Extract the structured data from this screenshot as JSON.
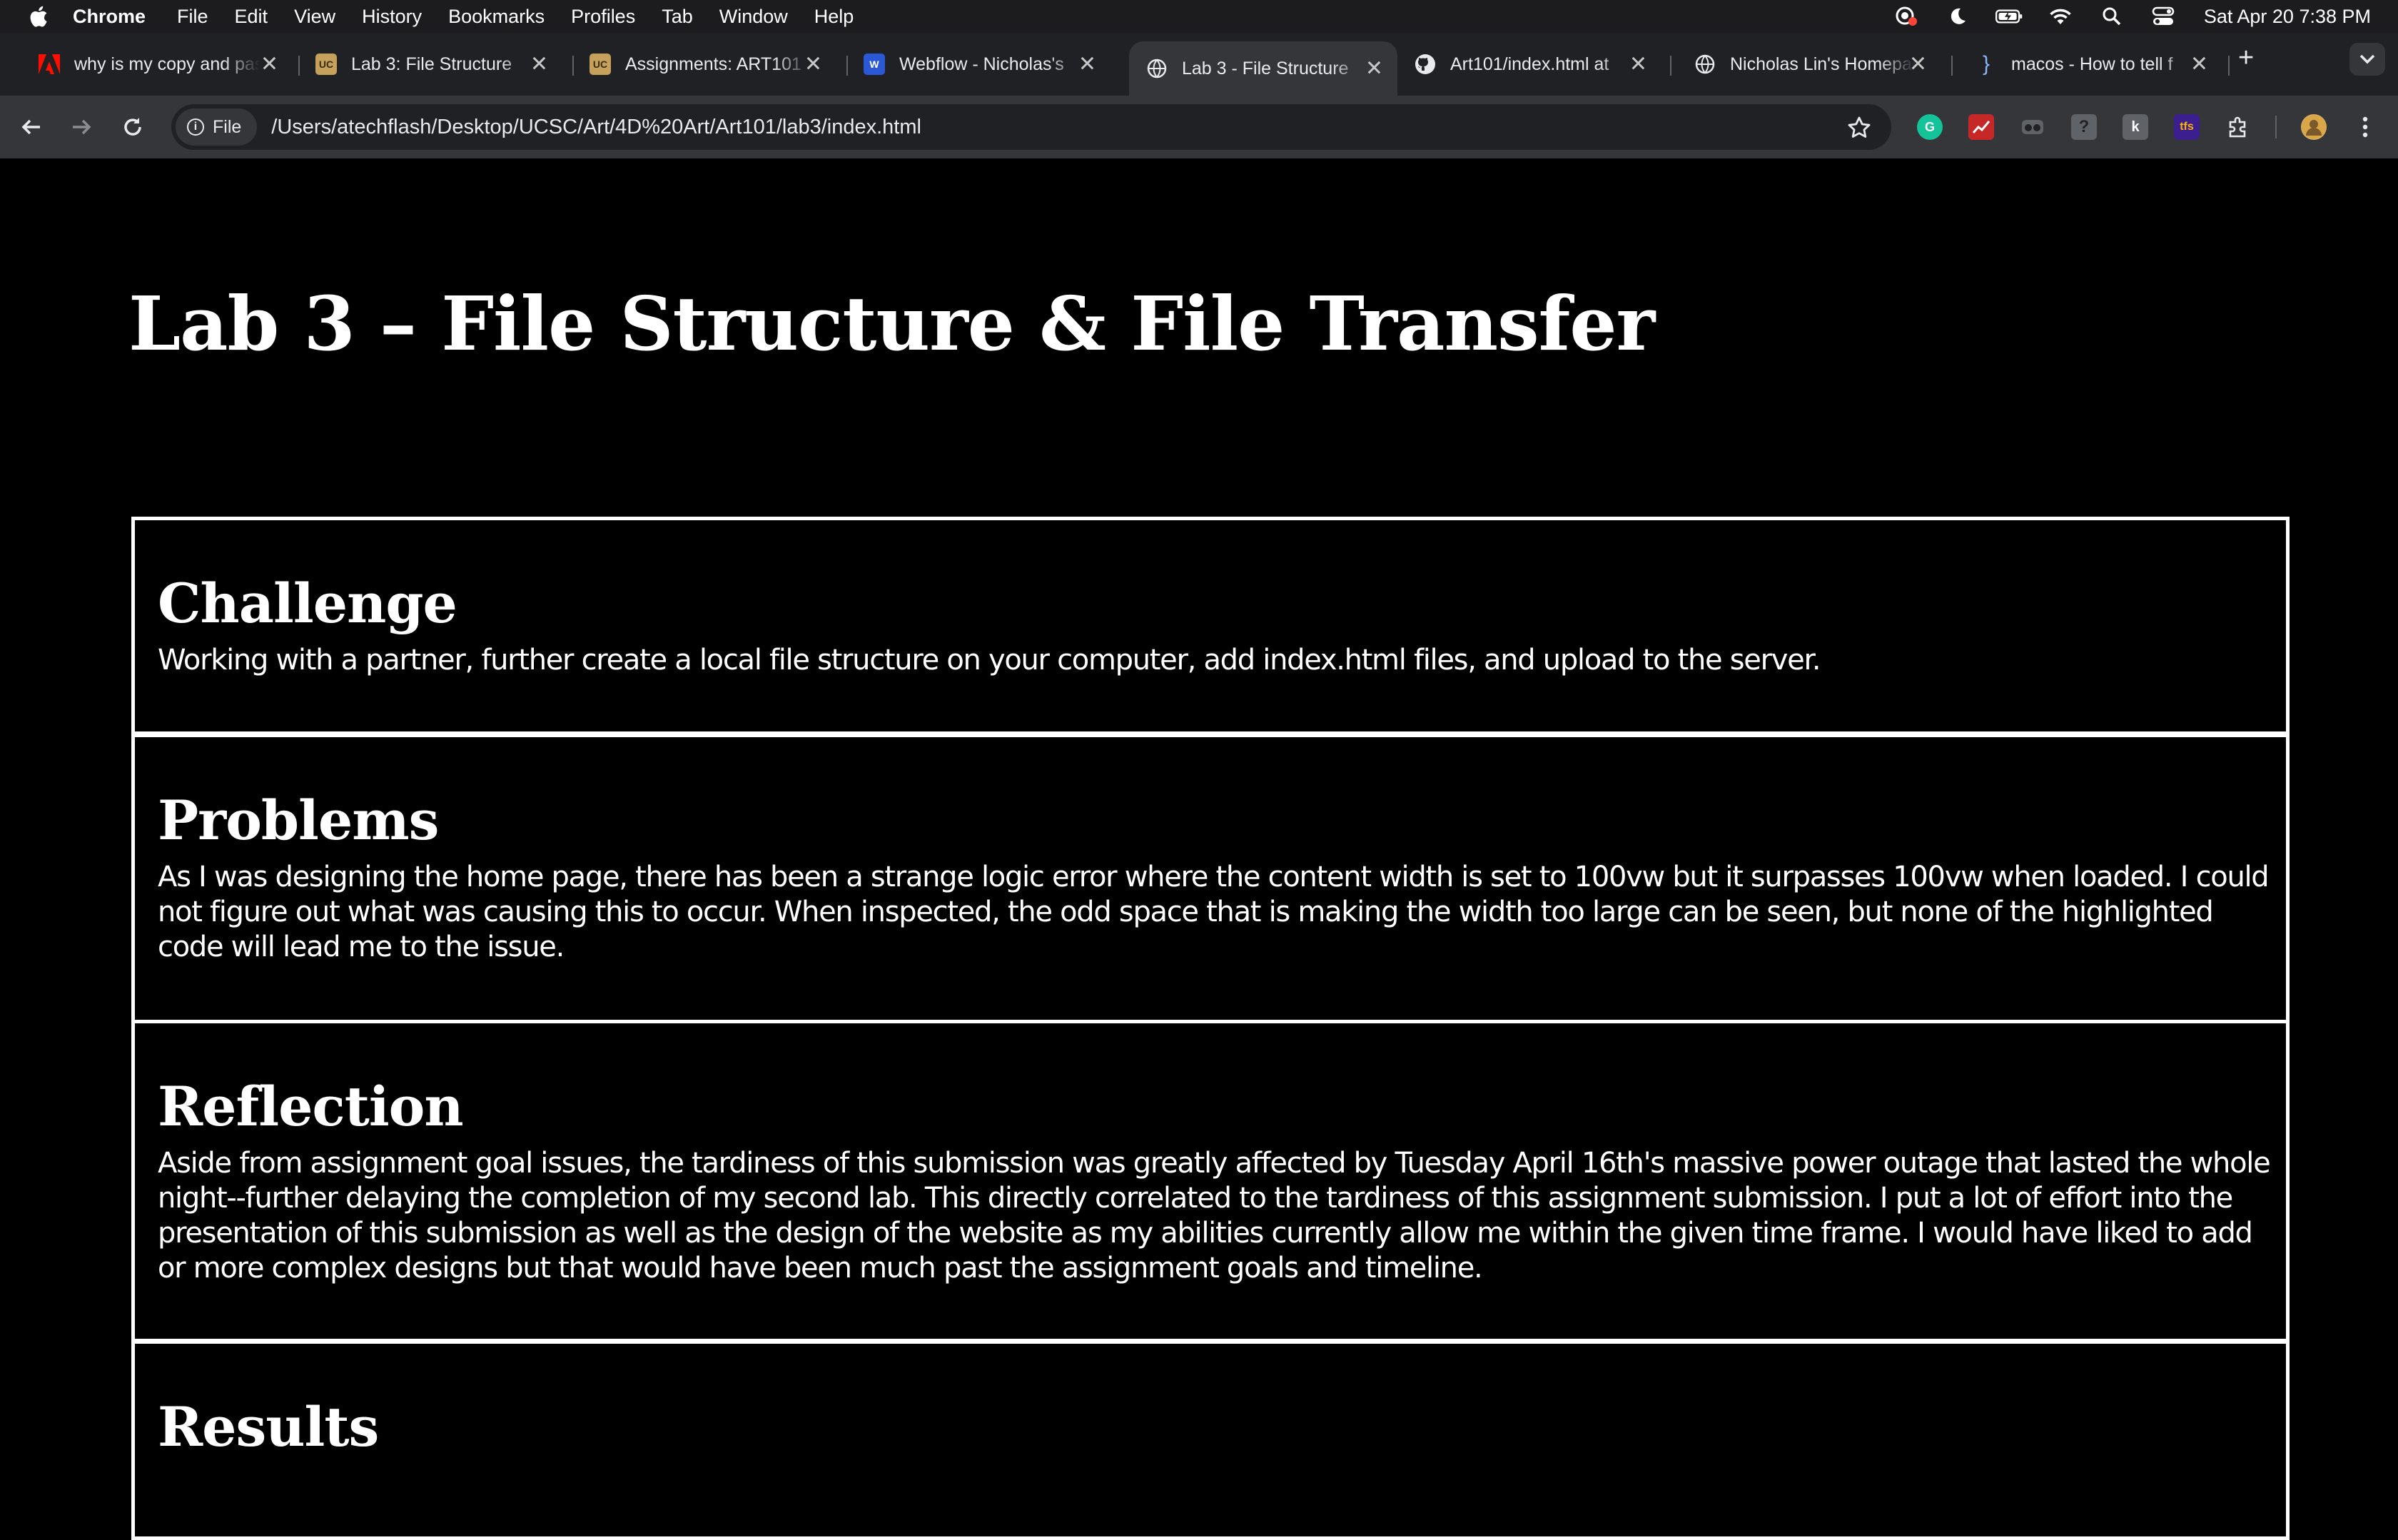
{
  "os_menubar": {
    "app_name": "Chrome",
    "menus": [
      "File",
      "Edit",
      "View",
      "History",
      "Bookmarks",
      "Profiles",
      "Tab",
      "Window",
      "Help"
    ],
    "clock": "Sat Apr 20  7:38 PM"
  },
  "browser": {
    "tabs": [
      {
        "title": "why is my copy and paste",
        "favicon": "adobe-icon",
        "active": false
      },
      {
        "title": "Lab 3: File Structure",
        "favicon": "ucsc-icon",
        "active": false
      },
      {
        "title": "Assignments: ART101",
        "favicon": "ucsc-icon",
        "active": false
      },
      {
        "title": "Webflow - Nicholas's",
        "favicon": "webflow-icon",
        "active": false
      },
      {
        "title": "Lab 3 - File Structure",
        "favicon": "globe-icon",
        "active": true
      },
      {
        "title": "Art101/index.html at",
        "favicon": "github-icon",
        "active": false
      },
      {
        "title": "Nicholas Lin's Homepage",
        "favicon": "globe-icon",
        "active": false
      },
      {
        "title": "macos - How to tell f",
        "favicon": "brace-icon",
        "active": false
      }
    ],
    "new_tab_label": "+",
    "address_chip": "File",
    "url": "/Users/atechflash/Desktop/UCSC/Art/4D%20Art/Art101/lab3/index.html",
    "colors": {
      "chrome_dark": "#202124",
      "toolbar": "#35363a",
      "text": "#e8eaed"
    }
  },
  "page": {
    "title": "Lab 3 – File Structure & File Transfer",
    "sections": [
      {
        "heading": "Challenge",
        "body": "Working with a partner, further create a local file structure on your computer, add index.html files, and upload to the server."
      },
      {
        "heading": "Problems",
        "body": "As I was designing the home page, there has been a strange logic error where the content width is set to 100vw but it surpasses 100vw when loaded. I could not figure out what was causing this to occur. When inspected, the odd space that is making the width too large can be seen, but none of the highlighted code will lead me to the issue."
      },
      {
        "heading": "Reflection",
        "body": "Aside from assignment goal issues, the tardiness of this submission was greatly affected by Tuesday April 16th's massive power outage that lasted the whole night--further delaying the completion of my second lab. This directly correlated to the tardiness of this assignment submission. I put a lot of effort into the presentation of this submission as well as the design of the website as my abilities currently allow me within the given time frame. I would have liked to add or more complex designs but that would have been much past the assignment goals and timeline."
      },
      {
        "heading": "Results",
        "body": ""
      }
    ]
  }
}
